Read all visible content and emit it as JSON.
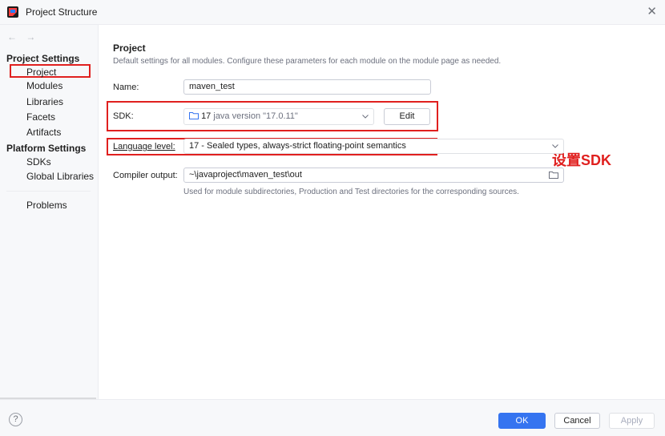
{
  "window": {
    "title": "Project Structure",
    "close_glyph": "✕"
  },
  "nav": {
    "back": "←",
    "forward": "→"
  },
  "sidebar": {
    "project_settings_header": "Project Settings",
    "project_settings_items": [
      "Project",
      "Modules",
      "Libraries",
      "Facets",
      "Artifacts"
    ],
    "platform_settings_header": "Platform Settings",
    "platform_settings_items": [
      "SDKs",
      "Global Libraries"
    ],
    "other_items": [
      "Problems"
    ],
    "selected": "Project"
  },
  "main": {
    "title": "Project",
    "description": "Default settings for all modules. Configure these parameters for each module on the module page as needed.",
    "name_label": "Name:",
    "name_value": "maven_test",
    "sdk_label": "SDK:",
    "sdk_version": "17",
    "sdk_detail": "java version \"17.0.11\"",
    "sdk_edit": "Edit",
    "language_level_label": "Language level:",
    "language_level_value": "17 - Sealed types, always-strict floating-point semantics",
    "compiler_output_label": "Compiler output:",
    "compiler_output_value": "~\\javaproject\\maven_test\\out",
    "compiler_output_hint": "Used for module subdirectories, Production and Test directories for the corresponding sources.",
    "annotation": "设置SDK"
  },
  "footer": {
    "help": "?",
    "ok": "OK",
    "cancel": "Cancel",
    "apply": "Apply"
  },
  "colors": {
    "accent": "#3574f0",
    "highlight": "#e0201f"
  },
  "icons": [
    "app-logo-icon",
    "close-icon",
    "back-arrow-icon",
    "forward-arrow-icon",
    "folder-icon",
    "chevron-down-icon",
    "help-icon"
  ]
}
